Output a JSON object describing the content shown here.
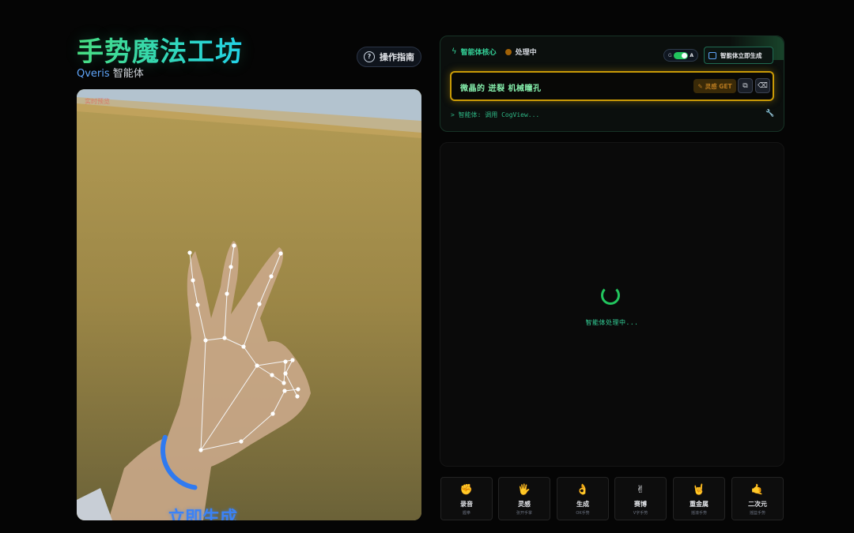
{
  "header": {
    "title": "手势魔法工坊",
    "brand": "Qveris",
    "subtitle_suffix": " 智能体",
    "guide_label": "操作指南"
  },
  "camera": {
    "status_label": "实时预览",
    "overlay_text": "立即生成",
    "progress_fraction": 0.28
  },
  "agent": {
    "title": "智能体核心",
    "status": "处理中",
    "toggle_left": "G",
    "toggle_right": "A",
    "quick_generate_label": "智能体立即生成",
    "prompt_text": "微晶的 迸裂 机械瞳孔",
    "inspiration_label": "灵感 GET",
    "log_text": "> 智能体: 调用 CogView..."
  },
  "output": {
    "loading_text": "智能体处理中..."
  },
  "gestures": [
    {
      "icon": "fist-icon",
      "glyph": "✊",
      "label": "录音",
      "sub": "握拳"
    },
    {
      "icon": "open-palm-icon",
      "glyph": "🖐",
      "label": "灵感",
      "sub": "张开手掌"
    },
    {
      "icon": "ok-hand-icon",
      "glyph": "👌",
      "label": "生成",
      "sub": "OK手势"
    },
    {
      "icon": "victory-hand-icon",
      "glyph": "✌",
      "label": "赛博",
      "sub": "V字手势"
    },
    {
      "icon": "rock-hand-icon",
      "glyph": "🤘",
      "label": "重金属",
      "sub": "摇滚手势"
    },
    {
      "icon": "call-me-hand-icon",
      "glyph": "🤙",
      "label": "二次元",
      "sub": "摇篮手势"
    }
  ],
  "colors": {
    "accent_green": "#34d399",
    "accent_blue": "#3b82f6",
    "prompt_border": "#c99a06",
    "background": "#050505"
  }
}
